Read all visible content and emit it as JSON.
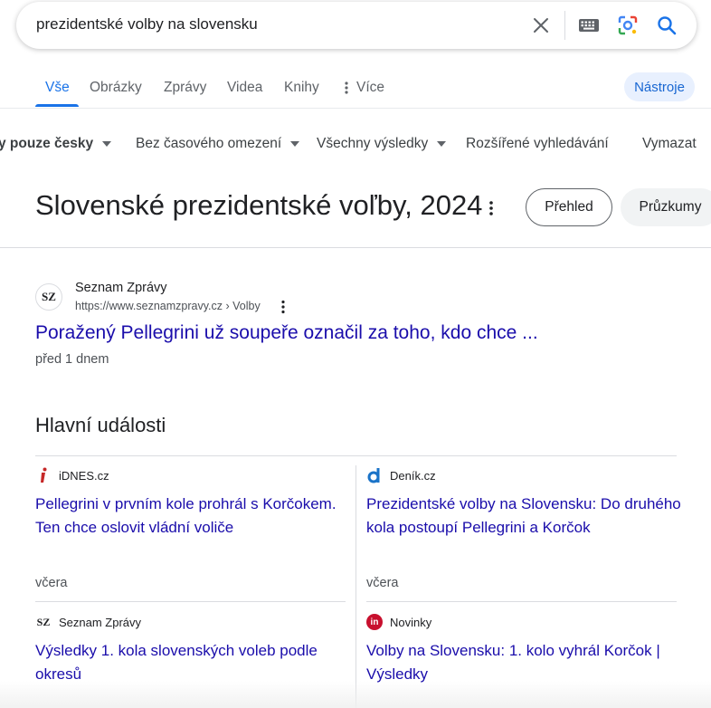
{
  "search": {
    "query": "prezidentské volby na slovensku"
  },
  "tabs": [
    {
      "label": "Vše",
      "active": true
    },
    {
      "label": "Obrázky"
    },
    {
      "label": "Zprávy"
    },
    {
      "label": "Videa"
    },
    {
      "label": "Knihy"
    },
    {
      "label": "Více"
    }
  ],
  "tools_label": "Nástroje",
  "filters": {
    "language": "y pouze česky",
    "time": "Bez časového omezení",
    "results": "Všechny výsledky",
    "advanced": "Rozšířené vyhledávání",
    "clear": "Vymazat"
  },
  "knowledge": {
    "title": "Slovenské prezidentské voľby, 2024",
    "chip_overview": "Přehled",
    "chip_polls": "Průzkumy"
  },
  "result": {
    "favicon_text": "SZ",
    "site_name": "Seznam Zprávy",
    "url": "https://www.seznamzpravy.cz › Volby",
    "title": "Poražený Pellegrini už soupeře označil za toho, kdo chce ...",
    "date": "před 1 dnem"
  },
  "top_stories": {
    "heading": "Hlavní události",
    "items": [
      {
        "source": "iDNES.cz",
        "icon": "idnes-icon",
        "headline": "Pellegrini v prvním kole prohrál s Korčokem. Ten chce oslovit vládní voliče",
        "when": "včera"
      },
      {
        "source": "Deník.cz",
        "icon": "denik-icon",
        "headline": "Prezidentské volby na Slovensku: Do druhého kola postoupí Pellegrini a Korčok",
        "when": "včera"
      },
      {
        "source": "Seznam Zprávy",
        "icon": "seznam-icon",
        "icon_text": "SZ",
        "headline": "Výsledky 1. kola slovenských voleb podle okresů"
      },
      {
        "source": "Novinky",
        "icon": "novinky-icon",
        "icon_text": "in",
        "headline": "Volby na Slovensku: 1. kolo vyhrál Korčok | Výsledky"
      }
    ]
  },
  "colors": {
    "link": "#1a0dab",
    "accent": "#1a73e8",
    "chip_bg": "#e8f0fe"
  }
}
